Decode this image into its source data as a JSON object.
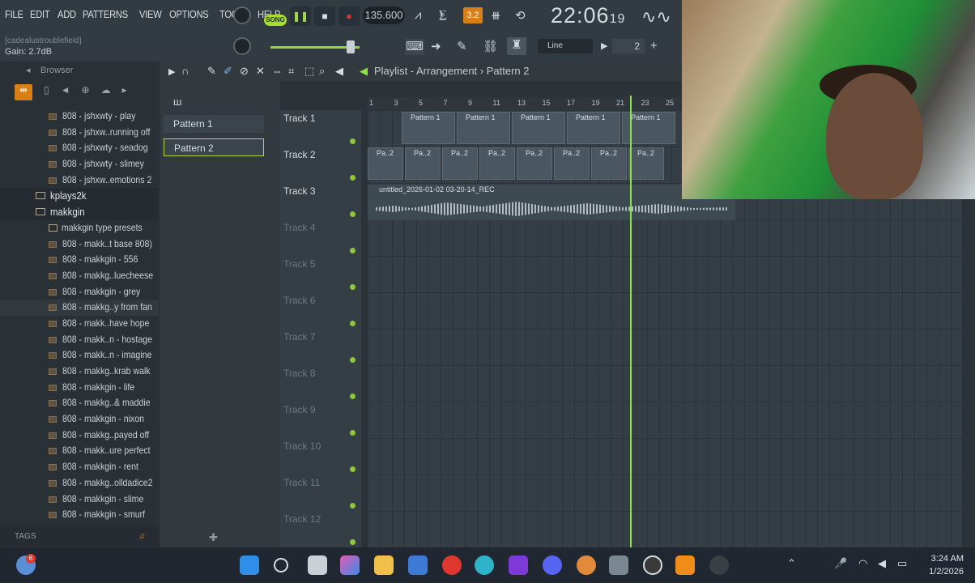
{
  "menu": [
    "FILE",
    "EDIT",
    "ADD",
    "PATTERNS",
    "VIEW",
    "OPTIONS",
    "TOOLS",
    "HELP"
  ],
  "hint": {
    "line1": "[cadealustroublefield]",
    "line2": "Gain:  2.7dB"
  },
  "transport": {
    "song_label": "SONG",
    "tempo": "135.600",
    "time": "22:06",
    "time_sub": "19",
    "tempo_tap_label": "3.2"
  },
  "toolbar": {
    "snap_mode": "Line",
    "snap_value": "2"
  },
  "browser": {
    "title": "Browser",
    "items": [
      {
        "label": "808 - jshxwty - play",
        "type": "file"
      },
      {
        "label": "808 - jshxw..running off",
        "type": "file"
      },
      {
        "label": "808 - jshxwty - seadog",
        "type": "file"
      },
      {
        "label": "808 - jshxwty - slimey",
        "type": "file"
      },
      {
        "label": "808 - jshxw..emotions 2",
        "type": "file"
      },
      {
        "label": "kplays2k",
        "type": "folder"
      },
      {
        "label": "makkgin",
        "type": "folder"
      },
      {
        "label": "makkgin type presets",
        "type": "sub"
      },
      {
        "label": "808 - makk..t base 808)",
        "type": "file"
      },
      {
        "label": "808 - makkgin - 556",
        "type": "file"
      },
      {
        "label": "808 - makkg..luecheese",
        "type": "file"
      },
      {
        "label": "808 - makkgin - grey",
        "type": "file"
      },
      {
        "label": "808 - makkg..y from fan",
        "type": "file",
        "highlight": true
      },
      {
        "label": "808 - makk..have hope",
        "type": "file"
      },
      {
        "label": "808 - makk..n - hostage",
        "type": "file"
      },
      {
        "label": "808 - makk..n - imagine",
        "type": "file"
      },
      {
        "label": "808 - makkg..krab walk",
        "type": "file"
      },
      {
        "label": "808 - makkgin - life",
        "type": "file"
      },
      {
        "label": "808 - makkg..& maddie",
        "type": "file"
      },
      {
        "label": "808 - makkgin - nixon",
        "type": "file"
      },
      {
        "label": "808 - makkg..payed off",
        "type": "file"
      },
      {
        "label": "808 - makk..ure perfect",
        "type": "file"
      },
      {
        "label": "808 - makkgin - rent",
        "type": "file"
      },
      {
        "label": "808 - makkg..olldadice2",
        "type": "file"
      },
      {
        "label": "808 - makkgin - slime",
        "type": "file"
      },
      {
        "label": "808 - makkgin - smurf",
        "type": "file"
      }
    ],
    "tags_label": "TAGS"
  },
  "patterns": [
    {
      "label": "Pattern 1",
      "selected": false
    },
    {
      "label": "Pattern 2",
      "selected": true
    }
  ],
  "playlist": {
    "title": "Playlist - Arrangement",
    "pattern": "Pattern 2",
    "ruler": [
      "1",
      "3",
      "5",
      "7",
      "9",
      "11",
      "13",
      "15",
      "17",
      "19",
      "21",
      "23",
      "25"
    ],
    "tracks": [
      "Track 1",
      "Track 2",
      "Track 3",
      "Track 4",
      "Track 5",
      "Track 6",
      "Track 7",
      "Track 8",
      "Track 9",
      "Track 10",
      "Track 11",
      "Track 12"
    ],
    "clip1_label": "Pattern 1",
    "clip2_label": "Pa..2",
    "audio_label": "untitled_2026-01-02 03-20-14_REC"
  },
  "taskbar": {
    "time": "3:24 AM",
    "date": "1/2/2026",
    "notif_count": "6"
  },
  "colors": {
    "accent": "#a6e02c",
    "playhead": "#8ee34a",
    "select_orange": "#d97f17"
  }
}
